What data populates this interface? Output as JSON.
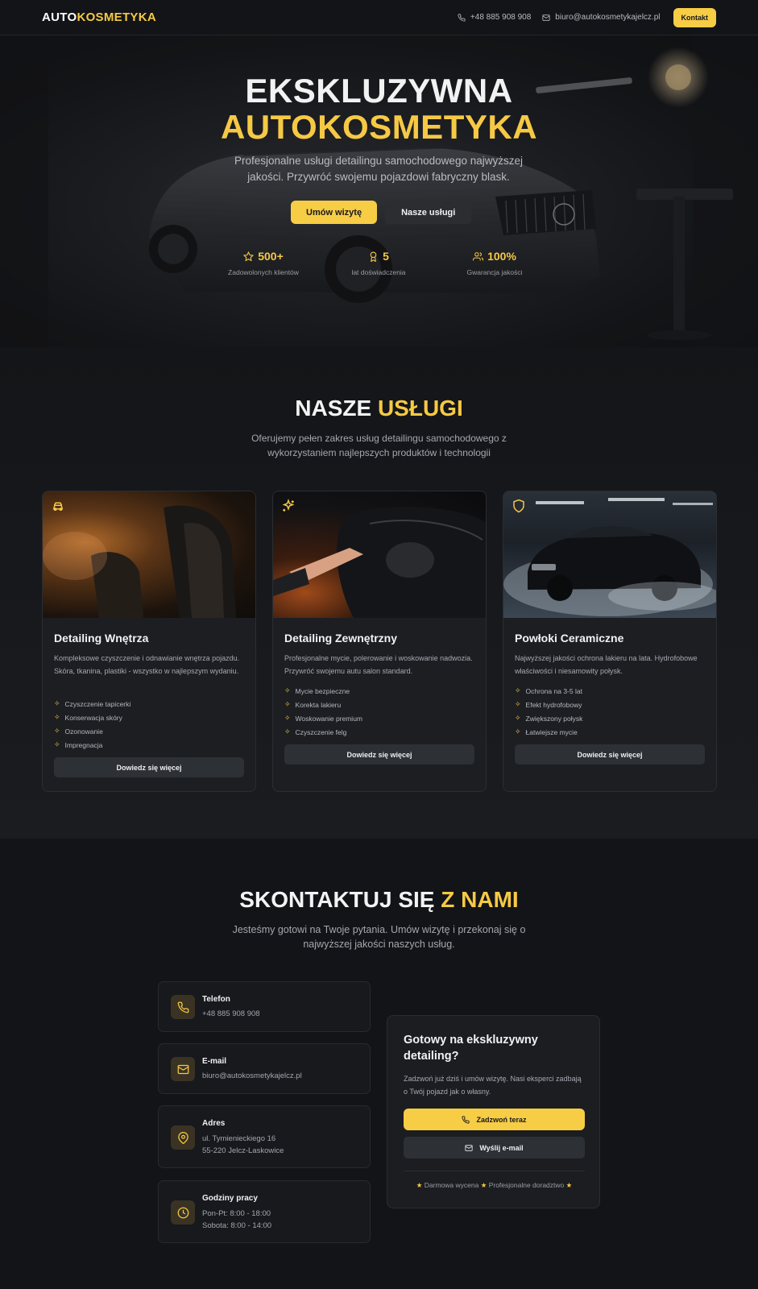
{
  "brand": {
    "part1": "AUTO",
    "part2": "KOSMETYKA"
  },
  "nav": {
    "phone": "+48 885 908 908",
    "email": "biuro@autokosmetykajelcz.pl",
    "contact_btn": "Kontakt"
  },
  "hero": {
    "title_line1": "EKSKLUZYWNA",
    "title_line2": "AUTOKOSMETYKA",
    "subtitle": "Profesjonalne usługi detailingu samochodowego najwyższej jakości. Przywróć swojemu pojazdowi fabryczny blask.",
    "btn_primary": "Umów wizytę",
    "btn_secondary": "Nasze usługi",
    "stats": [
      {
        "value": "500+",
        "label": "Zadowolonych klientów",
        "icon": "star-icon"
      },
      {
        "value": "5",
        "label": "lat doświadczenia",
        "icon": "award-icon"
      },
      {
        "value": "100%",
        "label": "Gwarancja jakości",
        "icon": "users-icon"
      }
    ]
  },
  "services": {
    "title_a": "NASZE ",
    "title_b": "USŁUGI",
    "subtitle": "Oferujemy pełen zakres usług detailingu samochodowego z wykorzystaniem najlepszych produktów i technologii",
    "cards": [
      {
        "title": "Detailing Wnętrza",
        "icon": "car-icon",
        "desc": "Kompleksowe czyszczenie i odnawianie wnętrza pojazdu. Skóra, tkanina, plastiki - wszystko w najlepszym wydaniu.",
        "items": [
          "Czyszczenie tapicerki",
          "Konserwacja skóry",
          "Ozonowanie",
          "Impregnacja"
        ],
        "more": "Dowiedz się więcej"
      },
      {
        "title": "Detailing Zewnętrzny",
        "icon": "sparkles-icon",
        "desc": "Profesjonalne mycie, polerowanie i woskowanie nadwozia. Przywróć swojemu autu salon standard.",
        "items": [
          "Mycie bezpieczne",
          "Korekta lakieru",
          "Woskowanie premium",
          "Czyszczenie felg"
        ],
        "more": "Dowiedz się więcej"
      },
      {
        "title": "Powłoki Ceramiczne",
        "icon": "shield-icon",
        "desc": "Najwyższej jakości ochrona lakieru na lata. Hydrofobowe właściwości i niesamowity połysk.",
        "items": [
          "Ochrona na 3-5 lat",
          "Efekt hydrofobowy",
          "Zwiększony połysk",
          "Łatwiejsze mycie"
        ],
        "more": "Dowiedz się więcej"
      }
    ]
  },
  "contact": {
    "title_a": "SKONTAKTUJ SIĘ ",
    "title_b": "Z NAMI",
    "subtitle": "Jesteśmy gotowi na Twoje pytania. Umów wizytę i przekonaj się o najwyższej jakości naszych usług.",
    "phone": {
      "label": "Telefon",
      "value": "+48 885 908 908"
    },
    "email": {
      "label": "E-mail",
      "value": "biuro@autokosmetykajelcz.pl"
    },
    "address": {
      "label": "Adres",
      "line1": "ul. Tymienieckiego 16",
      "line2": "55-220 Jelcz-Laskowice"
    },
    "hours": {
      "label": "Godziny pracy",
      "line1": "Pon-Pt: 8:00 - 18:00",
      "line2": "Sobota: 8:00 - 14:00"
    },
    "cta": {
      "title": "Gotowy na ekskluzywny detailing?",
      "text": "Zadzwoń już dziś i umów wizytę. Nasi eksperci zadbają o Twój pojazd jak o własny.",
      "call_btn": "Zadzwoń teraz",
      "mail_btn": "Wyślij e-mail",
      "feature1": "Darmowa wycena",
      "feature2": "Profesjonalne doradztwo"
    }
  },
  "colors": {
    "accent": "#f6c945",
    "background": "#121417",
    "card": "#1c1e22"
  }
}
